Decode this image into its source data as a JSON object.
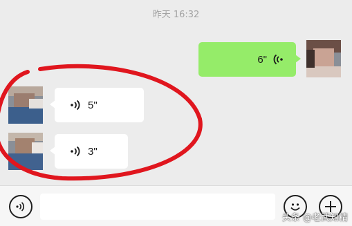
{
  "chat": {
    "timestamp": "昨天 16:32",
    "messages": [
      {
        "direction": "sent",
        "type": "voice",
        "duration": "6\""
      },
      {
        "direction": "received",
        "type": "voice",
        "duration": "5\""
      },
      {
        "direction": "received",
        "type": "voice",
        "duration": "3\""
      }
    ]
  },
  "input_bar": {
    "voice_toggle_icon": "voice-mode-icon",
    "emoji_icon": "emoji-icon",
    "more_icon": "plus-icon"
  },
  "annotation": {
    "color": "#e0161e",
    "shape": "ellipse"
  },
  "watermark": "头条 @老武知精",
  "colors": {
    "sent_bubble": "#95ec69",
    "received_bubble": "#ffffff",
    "chat_background": "#ececec",
    "timestamp_text": "#a3a3a3"
  }
}
